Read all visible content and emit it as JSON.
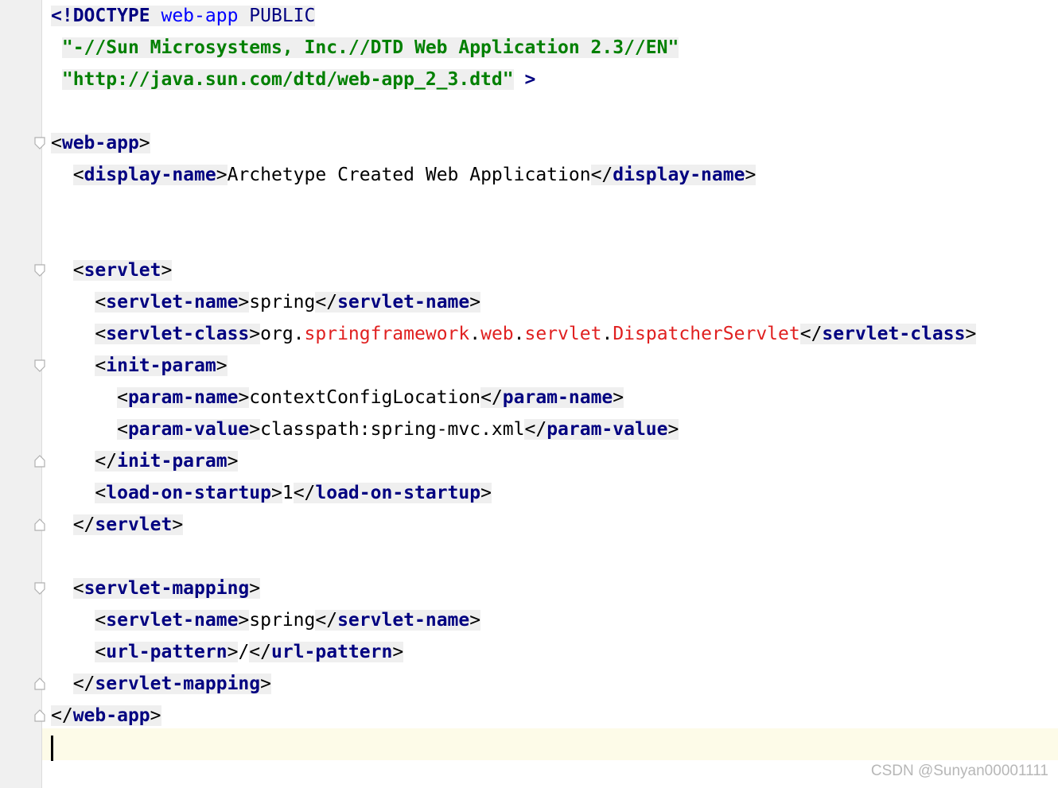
{
  "doctype": {
    "open": "<!DOCTYPE",
    "root": "web-app",
    "public": "PUBLIC",
    "public_id": "\"-//Sun Microsystems, Inc.//DTD Web Application 2.3//EN\"",
    "system_id": "\"http://java.sun.com/dtd/web-app_2_3.dtd\"",
    "close": ">"
  },
  "tags": {
    "web_app": "web-app",
    "display_name": "display-name",
    "servlet": "servlet",
    "servlet_name": "servlet-name",
    "servlet_class": "servlet-class",
    "init_param": "init-param",
    "param_name": "param-name",
    "param_value": "param-value",
    "load_on_startup": "load-on-startup",
    "servlet_mapping": "servlet-mapping",
    "url_pattern": "url-pattern"
  },
  "values": {
    "display_name": "Archetype Created Web Application",
    "servlet_name": "spring",
    "class_pkg_org": "org",
    "class_pkg_springframework": "springframework",
    "class_pkg_web": "web",
    "class_pkg_servlet": "servlet",
    "class_name": "DispatcherServlet",
    "param_name": "contextConfigLocation",
    "param_value": "classpath:spring-mvc.xml",
    "load_on_startup": "1",
    "mapping_servlet_name": "spring",
    "url_pattern": "/"
  },
  "watermark": "CSDN @Sunyan00001111",
  "colors": {
    "tag": "#000080",
    "string": "#008000",
    "class_ref": "#e02020",
    "doctype_name": "#0000ff",
    "tag_highlight": "#efefef",
    "gutter": "#f0f0f0",
    "current_line": "#fdfbe8"
  }
}
